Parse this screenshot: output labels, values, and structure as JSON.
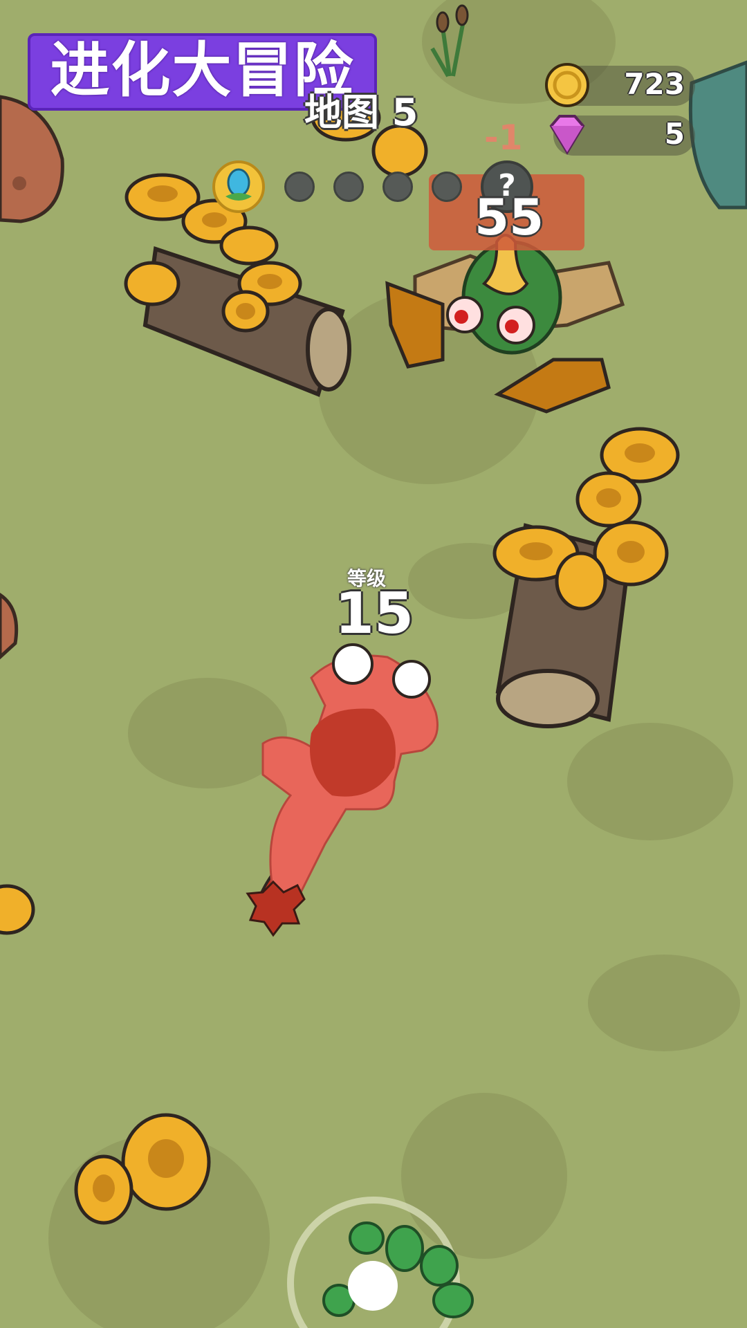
{
  "game": {
    "title": "进化大冒险",
    "map_label": "地图 5"
  },
  "resources": {
    "coins": "723",
    "gems": "5"
  },
  "progress": {
    "stages_total": 5,
    "stages_done": 0,
    "boss_slot_symbol": "?"
  },
  "enemy": {
    "level": "55",
    "damage_popup": "-1"
  },
  "player": {
    "level_label": "等级",
    "level": "15"
  },
  "icons": {
    "coin": "coin-icon",
    "gem": "gem-icon",
    "egg": "egg-icon"
  },
  "colors": {
    "ground": "#9fad6c",
    "title_banner": "#7b3fe0",
    "coin": "#f4c542",
    "gem": "#e878e8",
    "player": "#e8665a"
  }
}
